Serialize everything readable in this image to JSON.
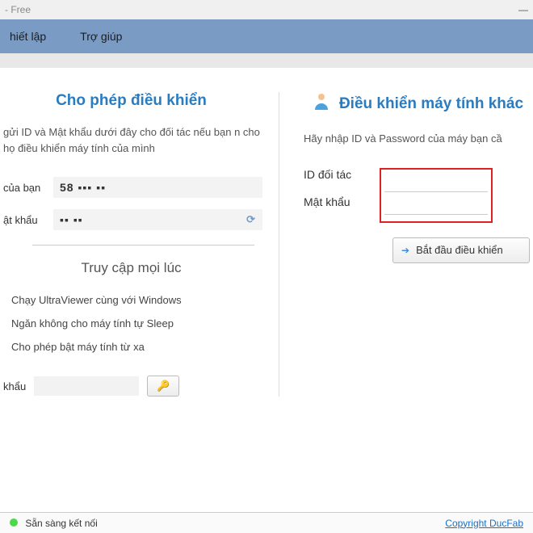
{
  "title_suffix": "- Free",
  "minimize": "—",
  "menu": {
    "settings": "hiết lập",
    "help": "Trợ giúp"
  },
  "left": {
    "heading": "Cho phép điều khiển",
    "desc": "gửi ID và Mật khẩu dưới đây cho đối tác nếu bạn n cho họ điều khiển máy tính của mình",
    "id_label": "của bạn",
    "id_value": "58 ▪▪▪ ▪▪",
    "pw_label": "ật khẩu",
    "pw_value": "▪▪ ▪▪",
    "subheading": "Truy cập mọi lúc",
    "opt1": "Chạy UltraViewer cùng với Windows",
    "opt2": "Ngăn không cho máy tính tự Sleep",
    "opt3": "Cho phép bật máy tính từ xa",
    "bottom_label": "khẩu"
  },
  "right": {
    "heading": "Điều khiển máy tính khác",
    "desc": "Hãy nhập ID và Password của máy bạn cầ",
    "id_label": "ID đối tác",
    "pw_label": "Mật khẩu",
    "start": "Bắt đầu điều khiển"
  },
  "status": {
    "text": "Sẵn sàng kết nối",
    "copyright": "Copyright DucFab"
  }
}
